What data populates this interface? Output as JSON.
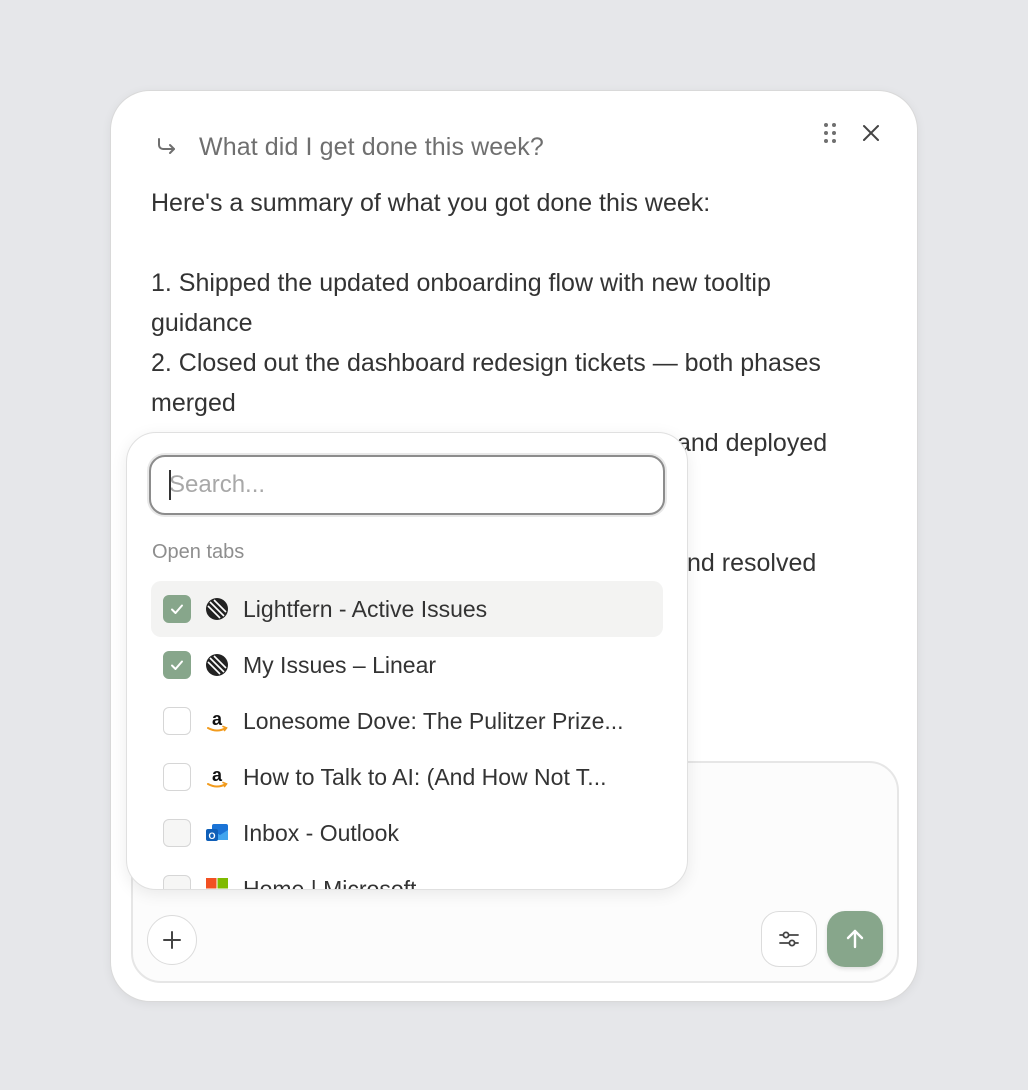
{
  "query": {
    "text": "What did I get done this week?",
    "icon": "reply-arrow-icon"
  },
  "answer": {
    "intro": "Here's a summary of what you got done this week:",
    "items": [
      "1. Shipped the updated onboarding flow with new tooltip guidance",
      "2. Closed out the dashboard redesign tickets — both phases merged",
      "and deployed",
      "nd resolved"
    ]
  },
  "popover": {
    "search_placeholder": "Search...",
    "section_label": "Open tabs",
    "tabs": [
      {
        "title": "Lightfern - Active Issues",
        "checked": true,
        "icon": "linear-icon"
      },
      {
        "title": "My Issues – Linear",
        "checked": true,
        "icon": "linear-icon"
      },
      {
        "title": "Lonesome Dove: The Pulitzer Prize...",
        "checked": false,
        "icon": "amazon-icon"
      },
      {
        "title": "How to Talk to AI: (And How Not T...",
        "checked": false,
        "icon": "amazon-icon"
      },
      {
        "title": "Inbox - Outlook",
        "checked": false,
        "icon": "outlook-icon"
      },
      {
        "title": "Home | Microsoft",
        "checked": false,
        "icon": "microsoft-icon"
      }
    ]
  },
  "colors": {
    "accent": "#87a68b",
    "background": "#e6e7ea"
  }
}
